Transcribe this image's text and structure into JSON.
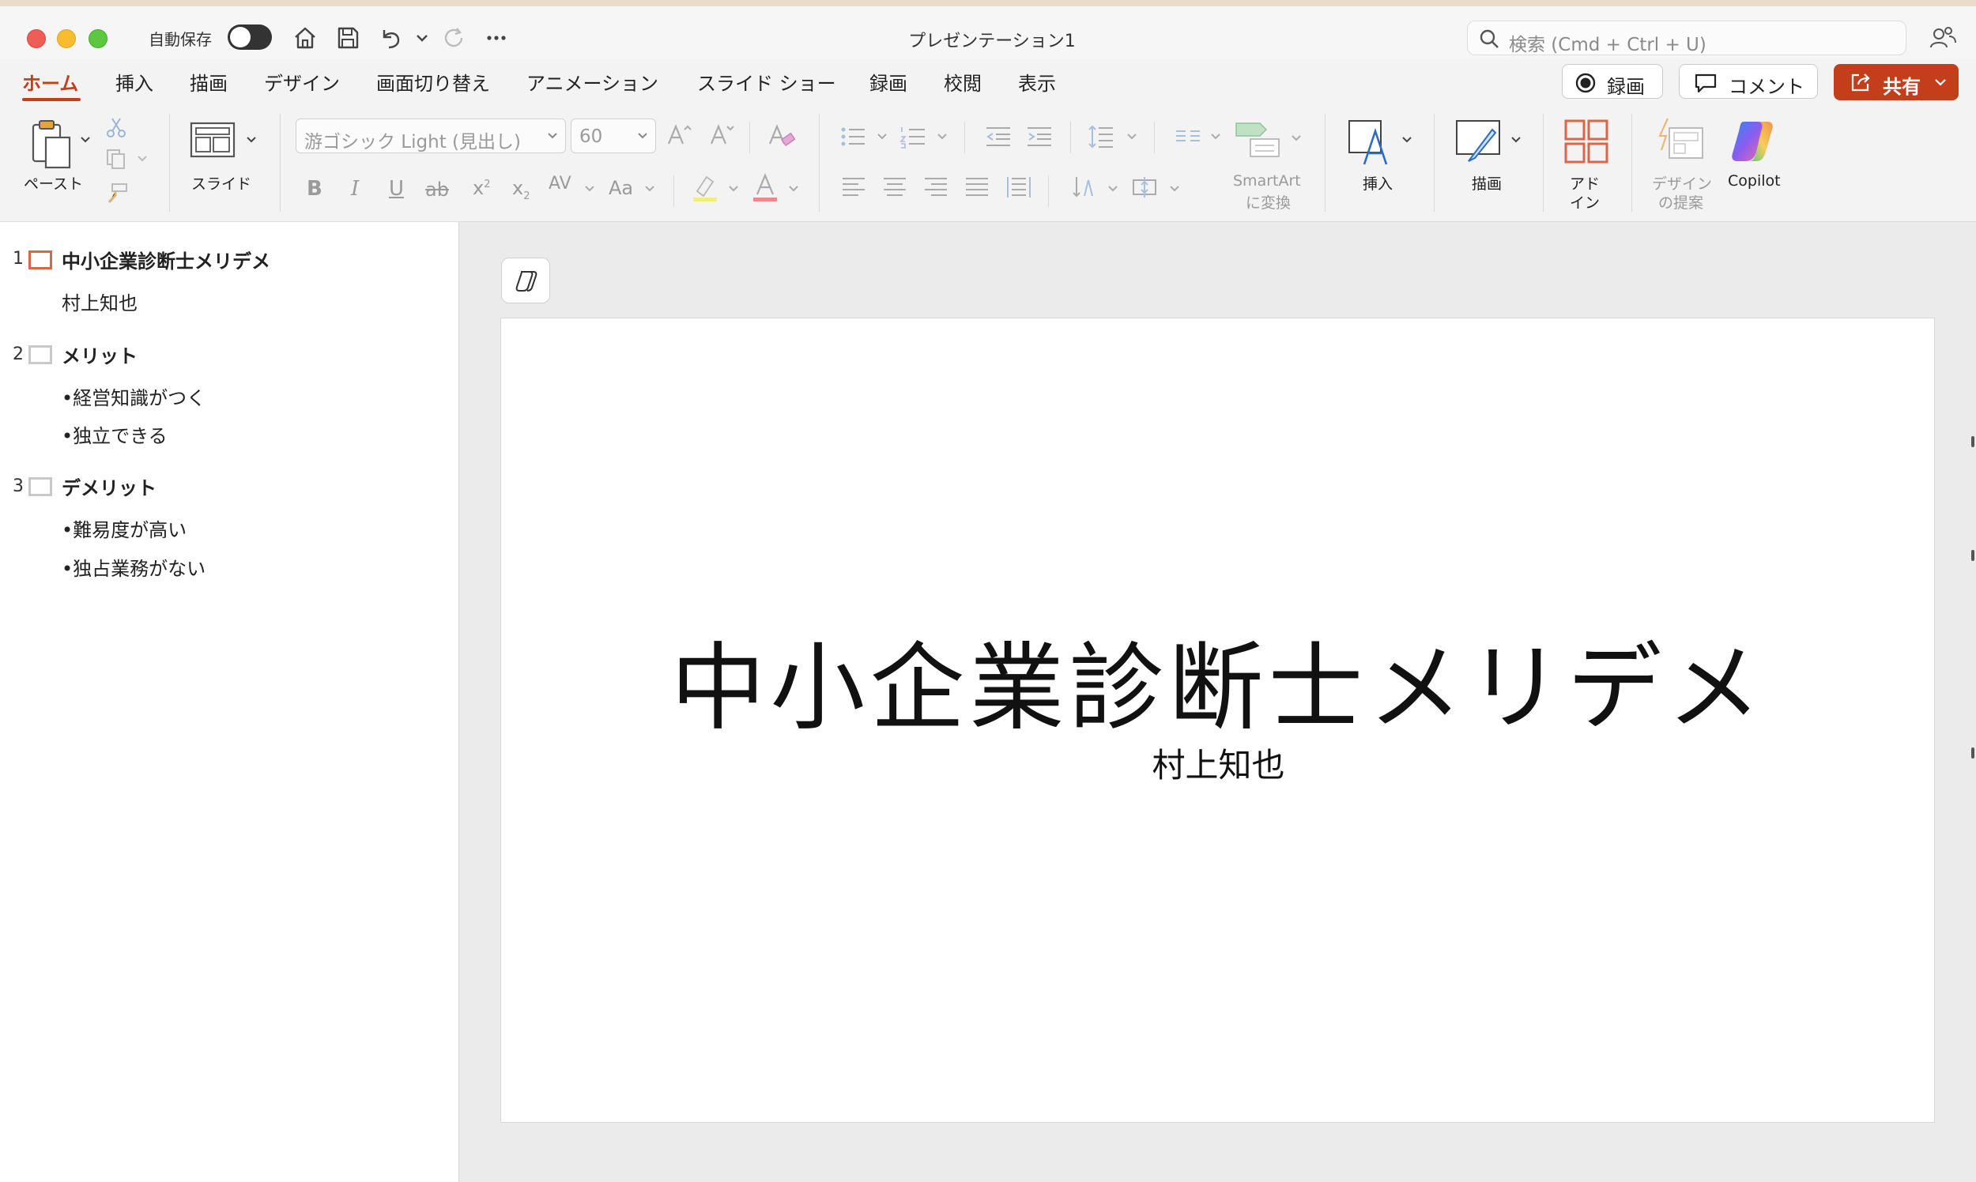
{
  "titlebar": {
    "autosave_label": "自動保存",
    "autosave_on": false,
    "document_title": "プレゼンテーション1",
    "search_placeholder": "検索 (Cmd + Ctrl + U)",
    "icons": [
      "home-icon",
      "save-icon",
      "undo-icon",
      "chevron-down-icon",
      "redo-icon",
      "more-icon",
      "search-icon",
      "people-icon"
    ]
  },
  "tabs": [
    {
      "label": "ホーム",
      "active": true
    },
    {
      "label": "挿入"
    },
    {
      "label": "描画"
    },
    {
      "label": "デザイン"
    },
    {
      "label": "画面切り替え"
    },
    {
      "label": "アニメーション"
    },
    {
      "label": "スライド ショー"
    },
    {
      "label": "録画"
    },
    {
      "label": "校閲"
    },
    {
      "label": "表示"
    }
  ],
  "actions": {
    "record_label": "録画",
    "comment_label": "コメント",
    "share_label": "共有"
  },
  "ribbon": {
    "paste_label": "ペースト",
    "slide_label": "スライド",
    "font_name": "游ゴシック Light (見出し)",
    "font_size": "60",
    "smartart_label_1": "SmartArt",
    "smartart_label_2": "に変換",
    "insert_label": "挿入",
    "draw_label": "描画",
    "addin_label_1": "アド",
    "addin_label_2": "イン",
    "design_label_1": "デザイン",
    "design_label_2": "の提案",
    "copilot_label": "Copilot",
    "format": {
      "bold": "B",
      "italic": "I",
      "underline": "U",
      "strike": "ab",
      "superscript": "x",
      "subscript": "x",
      "spacing": "AV",
      "case": "Aa"
    }
  },
  "outline": {
    "slides": [
      {
        "num": "1",
        "title": "中小企業診断士メリデメ",
        "lines": [
          "村上知也"
        ]
      },
      {
        "num": "2",
        "title": "メリット",
        "lines": [
          "•経営知識がつく",
          "•独立できる"
        ]
      },
      {
        "num": "3",
        "title": "デメリット",
        "lines": [
          "•難易度が高い",
          "•独占業務がない"
        ]
      }
    ]
  },
  "slide": {
    "title": "中小企業診断士メリデメ",
    "subtitle": "村上知也"
  },
  "colors": {
    "accent": "#c43e1c",
    "selection": "#d9664a"
  }
}
